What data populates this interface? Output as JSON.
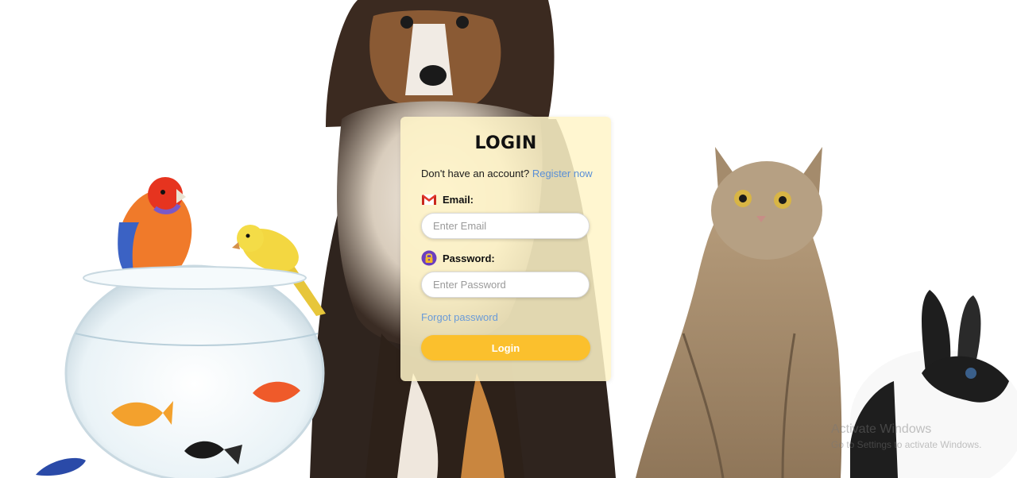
{
  "login": {
    "title": "LOGIN",
    "register_prompt": "Don't have an account?",
    "register_link": "Register now",
    "email_label": "Email:",
    "email_placeholder": "Enter Email",
    "email_value": "",
    "password_label": "Password:",
    "password_placeholder": "Enter Password",
    "password_value": "",
    "forgot_password": "Forgot password",
    "login_button": "Login"
  },
  "icons": {
    "email": "gmail-icon",
    "password": "lock-icon"
  },
  "colors": {
    "card_background": "#fff5c8",
    "link": "#5a8fd6",
    "button": "#fbc02d"
  },
  "os_watermark": {
    "title": "Activate Windows",
    "subtitle": "Go to Settings to activate Windows."
  }
}
